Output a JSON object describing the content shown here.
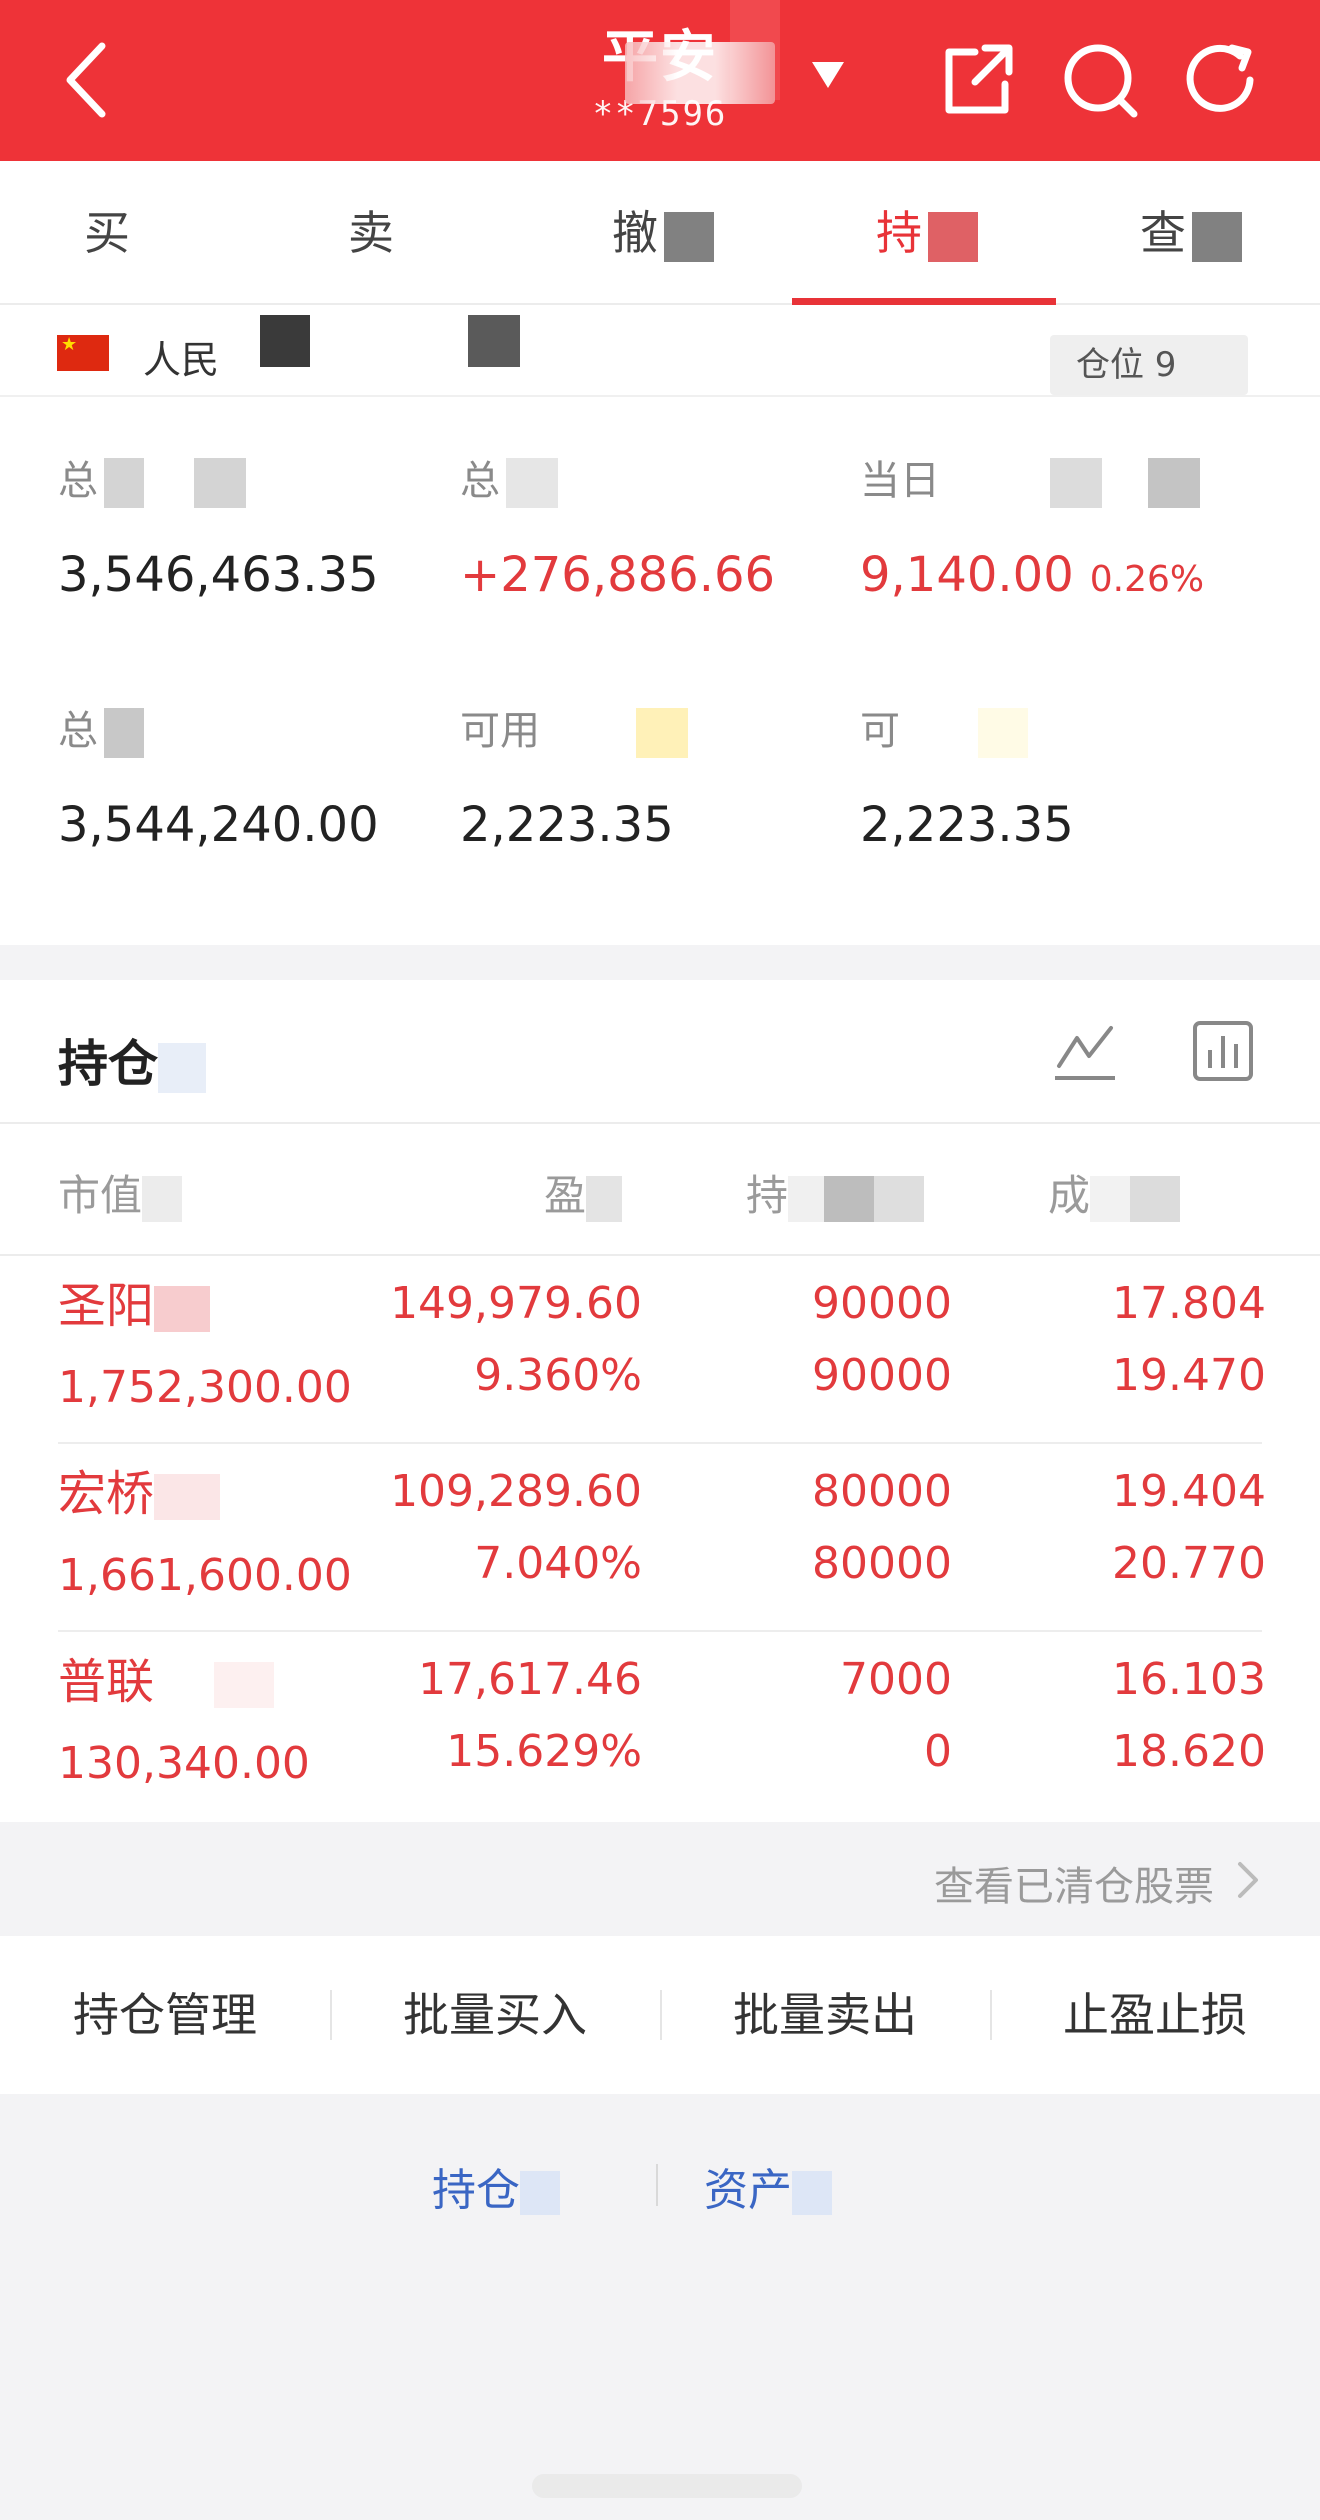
{
  "header": {
    "title": "平安",
    "account": "**7596",
    "icons": [
      "back-icon",
      "share-icon",
      "search-icon",
      "refresh-icon"
    ]
  },
  "tabs": [
    {
      "label": "买"
    },
    {
      "label": "卖"
    },
    {
      "label": "撤"
    },
    {
      "label": "持",
      "active": true
    },
    {
      "label": "查"
    }
  ],
  "summary": {
    "currency": "人民",
    "position_badge": "仓位 9",
    "metrics": [
      {
        "label": "总",
        "value": "3,546,463.35"
      },
      {
        "label": "总",
        "value": "+276,886.66"
      },
      {
        "label": "当日",
        "value": "9,140.00",
        "pct": "0.26%"
      },
      {
        "label": "总",
        "value": "3,544,240.00"
      },
      {
        "label": "可用",
        "value": "2,223.35"
      },
      {
        "label": "可",
        "value": "2,223.35"
      }
    ]
  },
  "holdings": {
    "title": "持仓",
    "columns": [
      "市值",
      "盈",
      "持",
      "成"
    ],
    "rows": [
      {
        "name": "圣阳",
        "market_value": "1,752,300.00",
        "pnl": "149,979.60",
        "pnl_pct": "9.360%",
        "qty": "90000",
        "avail": "90000",
        "cost": "17.804",
        "price": "19.470"
      },
      {
        "name": "宏桥",
        "market_value": "1,661,600.00",
        "pnl": "109,289.60",
        "pnl_pct": "7.040%",
        "qty": "80000",
        "avail": "80000",
        "cost": "19.404",
        "price": "20.770"
      },
      {
        "name": "普联",
        "market_value": "130,340.00",
        "pnl": "17,617.46",
        "pnl_pct": "15.629%",
        "qty": "7000",
        "avail": "0",
        "cost": "16.103",
        "price": "18.620"
      }
    ],
    "cleared_link": "查看已清仓股票"
  },
  "actions": [
    "持仓管理",
    "批量买入",
    "批量卖出",
    "止盈止损"
  ],
  "bottom_links": [
    "持仓",
    "资产"
  ],
  "colors": {
    "brand": "#ee3338",
    "up": "#e23a3d",
    "link": "#3a66c4"
  }
}
